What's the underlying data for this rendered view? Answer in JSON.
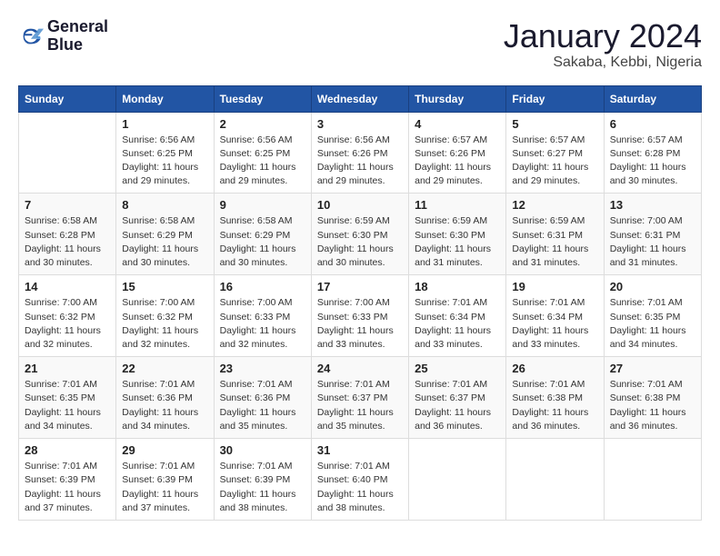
{
  "logo": {
    "line1": "General",
    "line2": "Blue"
  },
  "title": "January 2024",
  "subtitle": "Sakaba, Kebbi, Nigeria",
  "days_of_week": [
    "Sunday",
    "Monday",
    "Tuesday",
    "Wednesday",
    "Thursday",
    "Friday",
    "Saturday"
  ],
  "weeks": [
    [
      {
        "day": "",
        "info": ""
      },
      {
        "day": "1",
        "info": "Sunrise: 6:56 AM\nSunset: 6:25 PM\nDaylight: 11 hours\nand 29 minutes."
      },
      {
        "day": "2",
        "info": "Sunrise: 6:56 AM\nSunset: 6:25 PM\nDaylight: 11 hours\nand 29 minutes."
      },
      {
        "day": "3",
        "info": "Sunrise: 6:56 AM\nSunset: 6:26 PM\nDaylight: 11 hours\nand 29 minutes."
      },
      {
        "day": "4",
        "info": "Sunrise: 6:57 AM\nSunset: 6:26 PM\nDaylight: 11 hours\nand 29 minutes."
      },
      {
        "day": "5",
        "info": "Sunrise: 6:57 AM\nSunset: 6:27 PM\nDaylight: 11 hours\nand 29 minutes."
      },
      {
        "day": "6",
        "info": "Sunrise: 6:57 AM\nSunset: 6:28 PM\nDaylight: 11 hours\nand 30 minutes."
      }
    ],
    [
      {
        "day": "7",
        "info": "Sunrise: 6:58 AM\nSunset: 6:28 PM\nDaylight: 11 hours\nand 30 minutes."
      },
      {
        "day": "8",
        "info": "Sunrise: 6:58 AM\nSunset: 6:29 PM\nDaylight: 11 hours\nand 30 minutes."
      },
      {
        "day": "9",
        "info": "Sunrise: 6:58 AM\nSunset: 6:29 PM\nDaylight: 11 hours\nand 30 minutes."
      },
      {
        "day": "10",
        "info": "Sunrise: 6:59 AM\nSunset: 6:30 PM\nDaylight: 11 hours\nand 30 minutes."
      },
      {
        "day": "11",
        "info": "Sunrise: 6:59 AM\nSunset: 6:30 PM\nDaylight: 11 hours\nand 31 minutes."
      },
      {
        "day": "12",
        "info": "Sunrise: 6:59 AM\nSunset: 6:31 PM\nDaylight: 11 hours\nand 31 minutes."
      },
      {
        "day": "13",
        "info": "Sunrise: 7:00 AM\nSunset: 6:31 PM\nDaylight: 11 hours\nand 31 minutes."
      }
    ],
    [
      {
        "day": "14",
        "info": "Sunrise: 7:00 AM\nSunset: 6:32 PM\nDaylight: 11 hours\nand 32 minutes."
      },
      {
        "day": "15",
        "info": "Sunrise: 7:00 AM\nSunset: 6:32 PM\nDaylight: 11 hours\nand 32 minutes."
      },
      {
        "day": "16",
        "info": "Sunrise: 7:00 AM\nSunset: 6:33 PM\nDaylight: 11 hours\nand 32 minutes."
      },
      {
        "day": "17",
        "info": "Sunrise: 7:00 AM\nSunset: 6:33 PM\nDaylight: 11 hours\nand 33 minutes."
      },
      {
        "day": "18",
        "info": "Sunrise: 7:01 AM\nSunset: 6:34 PM\nDaylight: 11 hours\nand 33 minutes."
      },
      {
        "day": "19",
        "info": "Sunrise: 7:01 AM\nSunset: 6:34 PM\nDaylight: 11 hours\nand 33 minutes."
      },
      {
        "day": "20",
        "info": "Sunrise: 7:01 AM\nSunset: 6:35 PM\nDaylight: 11 hours\nand 34 minutes."
      }
    ],
    [
      {
        "day": "21",
        "info": "Sunrise: 7:01 AM\nSunset: 6:35 PM\nDaylight: 11 hours\nand 34 minutes."
      },
      {
        "day": "22",
        "info": "Sunrise: 7:01 AM\nSunset: 6:36 PM\nDaylight: 11 hours\nand 34 minutes."
      },
      {
        "day": "23",
        "info": "Sunrise: 7:01 AM\nSunset: 6:36 PM\nDaylight: 11 hours\nand 35 minutes."
      },
      {
        "day": "24",
        "info": "Sunrise: 7:01 AM\nSunset: 6:37 PM\nDaylight: 11 hours\nand 35 minutes."
      },
      {
        "day": "25",
        "info": "Sunrise: 7:01 AM\nSunset: 6:37 PM\nDaylight: 11 hours\nand 36 minutes."
      },
      {
        "day": "26",
        "info": "Sunrise: 7:01 AM\nSunset: 6:38 PM\nDaylight: 11 hours\nand 36 minutes."
      },
      {
        "day": "27",
        "info": "Sunrise: 7:01 AM\nSunset: 6:38 PM\nDaylight: 11 hours\nand 36 minutes."
      }
    ],
    [
      {
        "day": "28",
        "info": "Sunrise: 7:01 AM\nSunset: 6:39 PM\nDaylight: 11 hours\nand 37 minutes."
      },
      {
        "day": "29",
        "info": "Sunrise: 7:01 AM\nSunset: 6:39 PM\nDaylight: 11 hours\nand 37 minutes."
      },
      {
        "day": "30",
        "info": "Sunrise: 7:01 AM\nSunset: 6:39 PM\nDaylight: 11 hours\nand 38 minutes."
      },
      {
        "day": "31",
        "info": "Sunrise: 7:01 AM\nSunset: 6:40 PM\nDaylight: 11 hours\nand 38 minutes."
      },
      {
        "day": "",
        "info": ""
      },
      {
        "day": "",
        "info": ""
      },
      {
        "day": "",
        "info": ""
      }
    ]
  ]
}
